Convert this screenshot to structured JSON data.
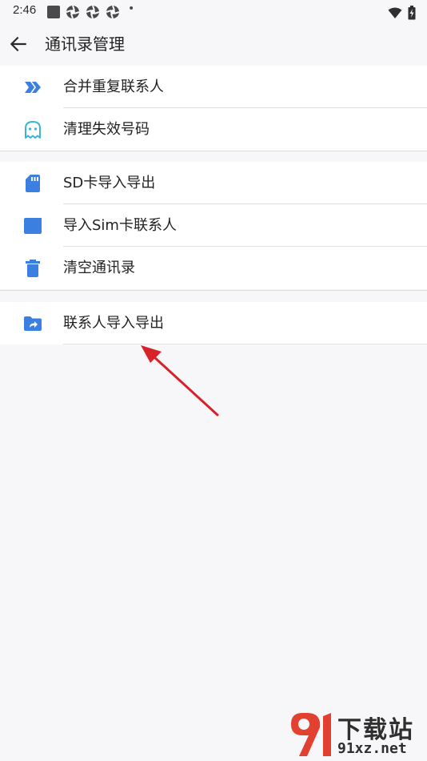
{
  "status_bar": {
    "time": "2:46",
    "notification_dot": "•"
  },
  "header": {
    "title": "通讯录管理"
  },
  "groups": [
    {
      "items": [
        {
          "label": "合并重复联系人",
          "icon": "merge-arrow-icon"
        },
        {
          "label": "清理失效号码",
          "icon": "ghost-icon"
        }
      ]
    },
    {
      "items": [
        {
          "label": "SD卡导入导出",
          "icon": "sd-card-icon"
        },
        {
          "label": "导入Sim卡联系人",
          "icon": "sim-card-icon"
        },
        {
          "label": "清空通讯录",
          "icon": "trash-icon"
        }
      ]
    },
    {
      "items": [
        {
          "label": "联系人导入导出",
          "icon": "folder-share-icon"
        }
      ]
    }
  ],
  "watermark": {
    "title": "下载站",
    "url": "91xz.net"
  },
  "colors": {
    "accent_blue": "#3b7fe0",
    "ghost_teal": "#39b6d6",
    "annotation_red": "#d8222a",
    "watermark_red": "#e2412f"
  }
}
